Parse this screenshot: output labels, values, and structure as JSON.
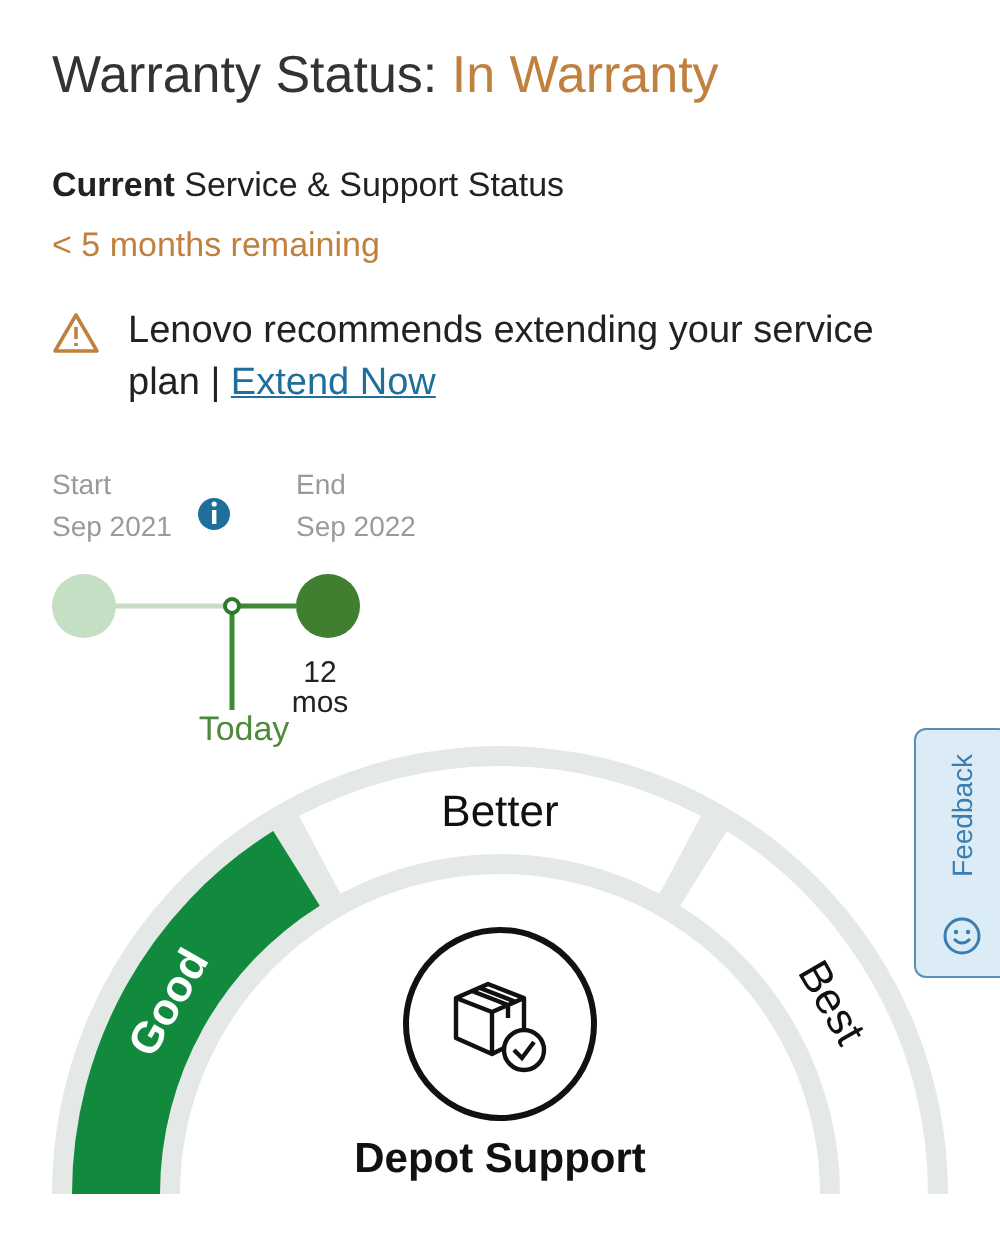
{
  "header": {
    "title": "Warranty Status:",
    "status": "In Warranty"
  },
  "support": {
    "heading": "**Current** Service & Support Status",
    "remaining": "< 5 months remaining"
  },
  "alert": {
    "text": "Lenovo recommends extending your service plan |",
    "link": "Extend Now"
  },
  "timeline": {
    "start_label": "Start",
    "start_date": "Sep 2021",
    "end_label": "End",
    "end_date": "Sep 2022",
    "duration": "12",
    "duration_unit": "mos",
    "today": "Today"
  },
  "plan_tiers": [
    {
      "label": "Good",
      "selected": true
    },
    {
      "label": "Better",
      "selected": false
    },
    {
      "label": "Best",
      "selected": false
    }
  ],
  "plan_name": "Depot Support",
  "feedback": {
    "label": "Feedback"
  }
}
